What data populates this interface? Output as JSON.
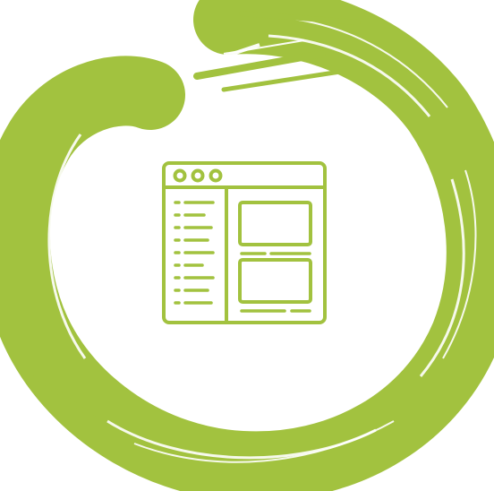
{
  "logo": {
    "icon_name": "web-layout-icon",
    "brush_ring_name": "brush-circle-ring",
    "colors": {
      "accent": "#a2c23f",
      "background": "#ffffff"
    }
  }
}
